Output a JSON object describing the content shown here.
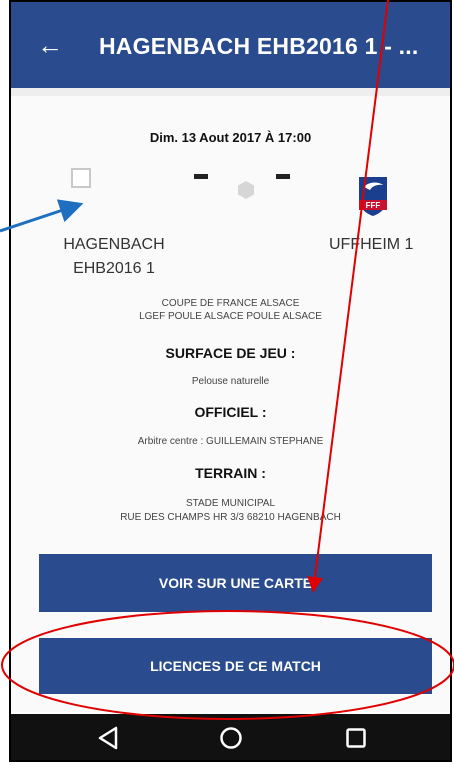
{
  "appbar": {
    "back_icon": "arrow-left-icon",
    "title": "HAGENBACH EHB2016 1 - ..."
  },
  "match": {
    "datetime": "Dim. 13 Aout 2017 À 17:00",
    "score_home": "-",
    "score_away": "-",
    "home_team": [
      "HAGENBACH",
      "EHB2016 1"
    ],
    "away_team": "UFFHEIM 1",
    "competition": "COUPE DE FRANCE ALSACE",
    "group": "LGEF POULE ALSACE POULE ALSACE"
  },
  "surface": {
    "heading": "SURFACE DE JEU :",
    "value": "Pelouse naturelle"
  },
  "officiel": {
    "heading": "OFFICIEL :",
    "value": "Arbitre centre : GUILLEMAIN STEPHANE"
  },
  "terrain": {
    "heading": "TERRAIN :",
    "name": "STADE MUNICIPAL",
    "address": "RUE DES CHAMPS HR 3/3 68210 HAGENBACH"
  },
  "buttons": {
    "map": "VOIR SUR UNE CARTE",
    "licences": "LICENCES DE CE MATCH"
  },
  "navbar": {
    "icons": [
      "back-triangle-icon",
      "home-circle-icon",
      "recents-square-icon"
    ]
  },
  "colors": {
    "primary": "#2a4b8d",
    "annotation_red": "#e00000",
    "annotation_blue": "#1f6fc0"
  },
  "ffflogo": {
    "text": "FFF"
  }
}
